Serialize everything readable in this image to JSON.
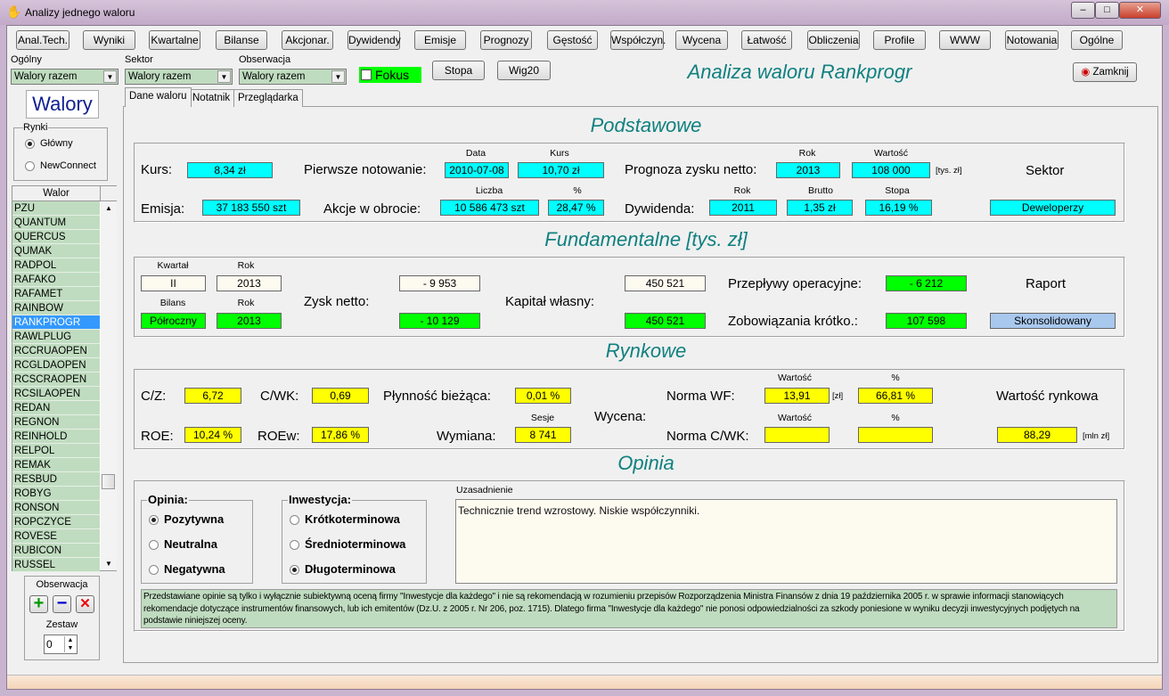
{
  "window": {
    "title": "Analizy  jednego  waloru",
    "controls": {
      "minimize": "–",
      "maximize": "□",
      "close": "✕"
    }
  },
  "toolbar": [
    "Anal.Tech.",
    "Wyniki",
    "Kwartalne",
    "Bilanse",
    "Akcjonar.",
    "Dywidendy",
    "Emisje",
    "Prognozy",
    "Gęstość",
    "Współczyn.",
    "Wycena",
    "Łatwość",
    "Obliczenia",
    "Profile",
    "WWW",
    "Notowania",
    "Ogólne"
  ],
  "filters": {
    "ogolny": {
      "label": "Ogólny",
      "value": "Walory razem"
    },
    "sektor": {
      "label": "Sektor",
      "value": "Walory razem"
    },
    "obserwacja": {
      "label": "Obserwacja",
      "value": "Walory razem"
    },
    "fokus": {
      "label": "Fokus",
      "checked": false,
      "color": "#00ff00"
    },
    "stopa": "Stopa",
    "wig20": "Wig20"
  },
  "header": {
    "title": "Analiza waloru Rankprogr",
    "close_button": "Zamknij",
    "accent": "#108080"
  },
  "left": {
    "walory": "Walory",
    "rynki": {
      "label": "Rynki",
      "options": [
        "Główny",
        "NewConnect"
      ],
      "selected": "Główny"
    },
    "list_header": "Walor",
    "items": [
      "PZU",
      "QUANTUM",
      "QUERCUS",
      "QUMAK",
      "RADPOL",
      "RAFAKO",
      "RAFAMET",
      "RAINBOW",
      "RANKPROGR",
      "RAWLPLUG",
      "RCCRUAOPEN",
      "RCGLDAOPEN",
      "RCSCRAOPEN",
      "RCSILAOPEN",
      "REDAN",
      "REGNON",
      "REINHOLD",
      "RELPOL",
      "REMAK",
      "RESBUD",
      "ROBYG",
      "RONSON",
      "ROPCZYCE",
      "ROVESE",
      "RUBICON",
      "RUSSEL"
    ],
    "selected": "RANKPROGR",
    "obserwacja": {
      "label": "Obserwacja",
      "add": "+",
      "remove": "−",
      "delete": "✕",
      "zestaw_label": "Zestaw",
      "zestaw_value": "0"
    }
  },
  "tabs": [
    "Dane waloru",
    "Notatnik",
    "Przeglądarka"
  ],
  "podstawowe": {
    "title": "Podstawowe",
    "kurs_label": "Kurs:",
    "kurs": "8,34 zł",
    "pierwsze_label": "Pierwsze notowanie:",
    "data_h": "Data",
    "data": "2010-07-08",
    "kurs_h": "Kurs",
    "kurs_pierwszy": "10,70 zł",
    "prognoza_label": "Prognoza zysku netto:",
    "rok_h": "Rok",
    "prognoza_rok": "2013",
    "wartosc_h": "Wartość",
    "prognoza_wartosc": "108 000",
    "prognoza_unit": "[tys. zł]",
    "sektor_label": "Sektor",
    "sektor": "Deweloperzy",
    "emisja_label": "Emisja:",
    "emisja": "37 183 550 szt",
    "akcje_label": "Akcje w obrocie:",
    "liczba_h": "Liczba",
    "akcje_liczba": "10 586 473 szt",
    "pct_h": "%",
    "akcje_pct": "28,47 %",
    "dywidenda_label": "Dywidenda:",
    "dyw_rok_h": "Rok",
    "dyw_rok": "2011",
    "brutto_h": "Brutto",
    "dyw_brutto": "1,35 zł",
    "stopa_h": "Stopa",
    "dyw_stopa": "16,19 %"
  },
  "fundamentalne": {
    "title": "Fundamentalne  [tys. zł]",
    "kwartal_h": "Kwartał",
    "kwartal": "II",
    "rok_h": "Rok",
    "rok1": "2013",
    "bilans_h": "Bilans",
    "bilans": "Półroczny",
    "rok2": "2013",
    "zysk_label": "Zysk netto:",
    "zysk1": "- 9 953",
    "zysk2": "- 10 129",
    "kapital_label": "Kapitał własny:",
    "kapital1": "450 521",
    "kapital2": "450 521",
    "przeplywy_label": "Przepływy operacyjne:",
    "przeplywy": "- 6 212",
    "zobow_label": "Zobowiązania krótko.:",
    "zobow": "107 598",
    "raport_label": "Raport",
    "raport": "Skonsolidowany"
  },
  "rynkowe": {
    "title": "Rynkowe",
    "cz_label": "C/Z:",
    "cz": "6,72",
    "cwk_label": "C/WK:",
    "cwk": "0,69",
    "plyn_label": "Płynność bieżąca:",
    "plyn": "0,01 %",
    "roe_label": "ROE:",
    "roe": "10,24 %",
    "roew_label": "ROEw:",
    "roew": "17,86 %",
    "wymiana_label": "Wymiana:",
    "sesje_h": "Sesje",
    "wymiana": "8 741",
    "wycena_label": "Wycena:",
    "normawf_label": "Norma WF:",
    "wartosc_h": "Wartość",
    "pct_h": "%",
    "normawf": "13,91",
    "normawf_unit": "[zł]",
    "normawf_pct": "66,81 %",
    "normacwk_label": "Norma C/WK:",
    "normacwk": "",
    "normacwk_pct": "",
    "wr_label": "Wartość rynkowa",
    "wr": "88,29",
    "wr_unit": "[mln zł]"
  },
  "opinia": {
    "title": "Opinia",
    "opinia_label": "Opinia:",
    "opinia_options": [
      "Pozytywna",
      "Neutralna",
      "Negatywna"
    ],
    "opinia_selected": "Pozytywna",
    "inwestycja_label": "Inwestycja:",
    "inwestycja_options": [
      "Krótkoterminowa",
      "Średnioterminowa",
      "Długoterminowa"
    ],
    "inwestycja_selected": "Długoterminowa",
    "uzasadnienie_label": "Uzasadnienie",
    "uzasadnienie": "Technicznie trend wzrostowy. Niskie współczynniki.",
    "disclaimer": "Przedstawiane opinie są tylko i wyłącznie subiektywną oceną firmy \"Inwestycje dla każdego\" i nie są rekomendacją w rozumieniu przepisów Rozporządzenia Ministra Finansów z dnia 19 października 2005 r. w sprawie informacji stanowiących rekomendacje dotyczące instrumentów finansowych, lub ich emitentów (Dz.U. z 2005 r. Nr 206, poz. 1715). Dlatego firma \"Inwestycje dla każdego\" nie ponosi odpowiedzialności za szkody poniesione w wyniku decyzji inwestycyjnych podjętych na podstawie niniejszej oceny."
  }
}
